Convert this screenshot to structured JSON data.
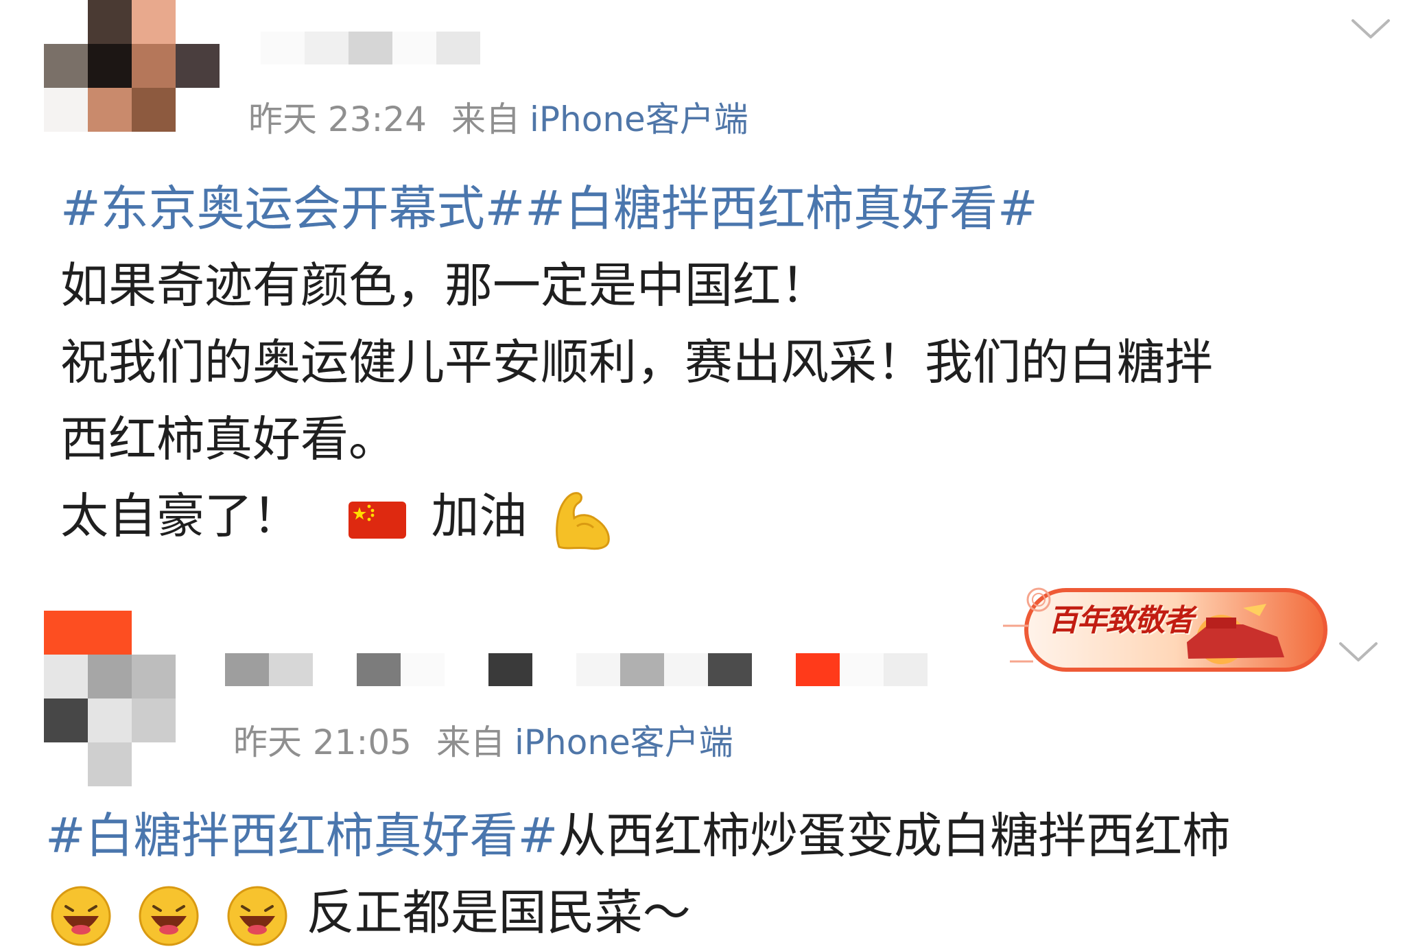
{
  "posts": [
    {
      "time": "昨天 23:24",
      "from_label": "来自",
      "source": "iPhone客户端",
      "topic_line": "#东京奥运会开幕式##白糖拌西红柿真好看#",
      "lines": [
        "如果奇迹有颜色，那一定是中国红！",
        "祝我们的奥运健儿平安顺利，赛出风采！我们的白糖拌",
        "西红柿真好看。"
      ],
      "last_line_text_1": "太自豪了！",
      "last_line_text_2": "加油"
    },
    {
      "time": "昨天 21:05",
      "from_label": "来自",
      "source": "iPhone客户端",
      "topic": "#白糖拌西红柿真好看#",
      "text_after_topic": "从西红柿炒蛋变成白糖拌西红柿",
      "second_line_text": "反正都是国民菜～",
      "badge_text": "百年致敬者"
    }
  ],
  "icons": {
    "expand": "chevron-down-icon",
    "flag": "china-flag-icon",
    "muscle": "flexed-biceps-icon",
    "laugh": "laughing-face-icon"
  },
  "colors": {
    "topic_blue": "#4a76ad",
    "source_blue": "#4f76a8",
    "meta_gray": "#8f8f8f",
    "text": "#1f1f1f"
  }
}
